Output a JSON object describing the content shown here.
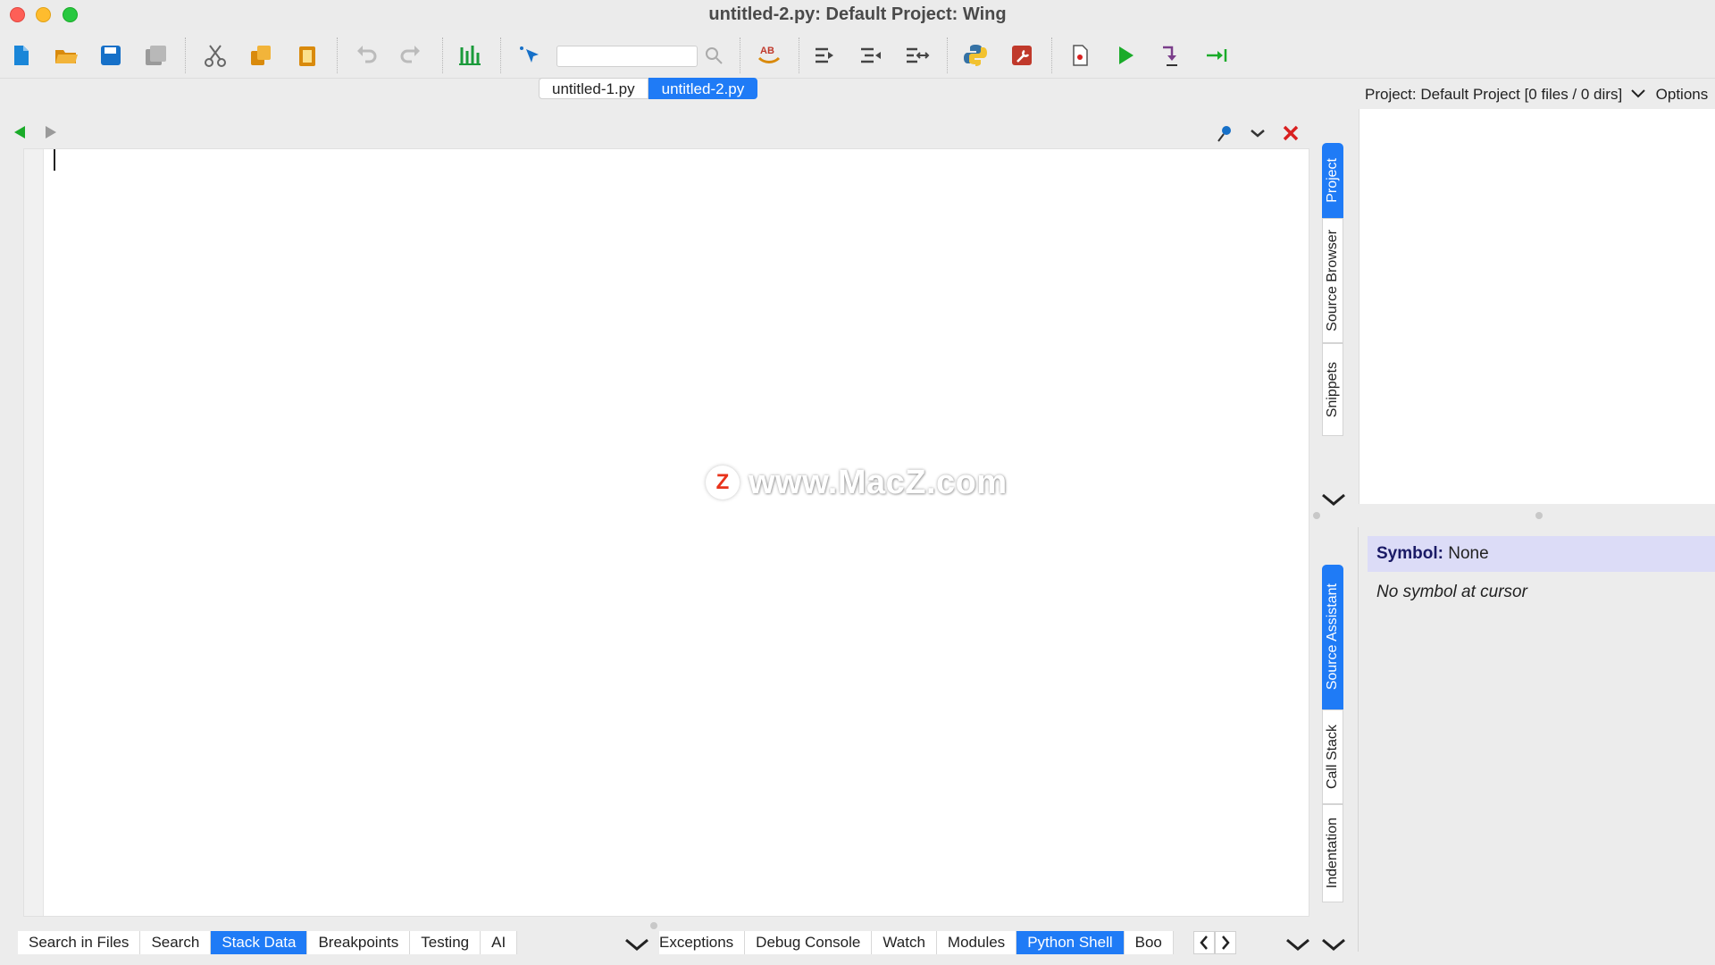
{
  "window": {
    "title": "untitled-2.py: Default Project: Wing"
  },
  "toolbar": {
    "search_value": "",
    "buttons": [
      "new-file",
      "open-file",
      "save",
      "save-all",
      "cut",
      "copy",
      "paste",
      "undo",
      "redo",
      "indent-guides",
      "select-target",
      "search",
      "spell-check",
      "indent",
      "outdent",
      "indent-toggle",
      "python-shell",
      "debug-config",
      "stop",
      "run",
      "step-into",
      "step-out"
    ]
  },
  "editor": {
    "tabs": [
      {
        "label": "untitled-1.py",
        "active": false
      },
      {
        "label": "untitled-2.py",
        "active": true
      }
    ]
  },
  "watermark": {
    "logo": "Z",
    "text": "www.MacZ.com"
  },
  "bottom_left": {
    "tabs": [
      {
        "label": "Search in Files",
        "active": false
      },
      {
        "label": "Search",
        "active": false
      },
      {
        "label": "Stack Data",
        "active": true
      },
      {
        "label": "Breakpoints",
        "active": false
      },
      {
        "label": "Testing",
        "active": false
      },
      {
        "label": "AI",
        "active": false
      }
    ]
  },
  "bottom_right": {
    "tabs": [
      {
        "label": "Exceptions",
        "active": false
      },
      {
        "label": "Debug Console",
        "active": false
      },
      {
        "label": "Watch",
        "active": false
      },
      {
        "label": "Modules",
        "active": false
      },
      {
        "label": "Python Shell",
        "active": true
      },
      {
        "label": "Boo",
        "active": false
      }
    ]
  },
  "right_top": {
    "vtabs": [
      {
        "label": "Project",
        "active": true
      },
      {
        "label": "Source Browser",
        "active": false
      },
      {
        "label": "Snippets",
        "active": false
      }
    ],
    "header": "Project: Default Project [0 files / 0 dirs]",
    "options_label": "Options"
  },
  "right_bottom": {
    "vtabs": [
      {
        "label": "Source Assistant",
        "active": true
      },
      {
        "label": "Call Stack",
        "active": false
      },
      {
        "label": "Indentation",
        "active": false
      }
    ],
    "symbol_label": "Symbol:",
    "symbol_value": "None",
    "no_symbol": "No symbol at cursor"
  },
  "colors": {
    "accent": "#1f7bf6",
    "run_green": "#1aab29",
    "close_red": "#d92020"
  }
}
